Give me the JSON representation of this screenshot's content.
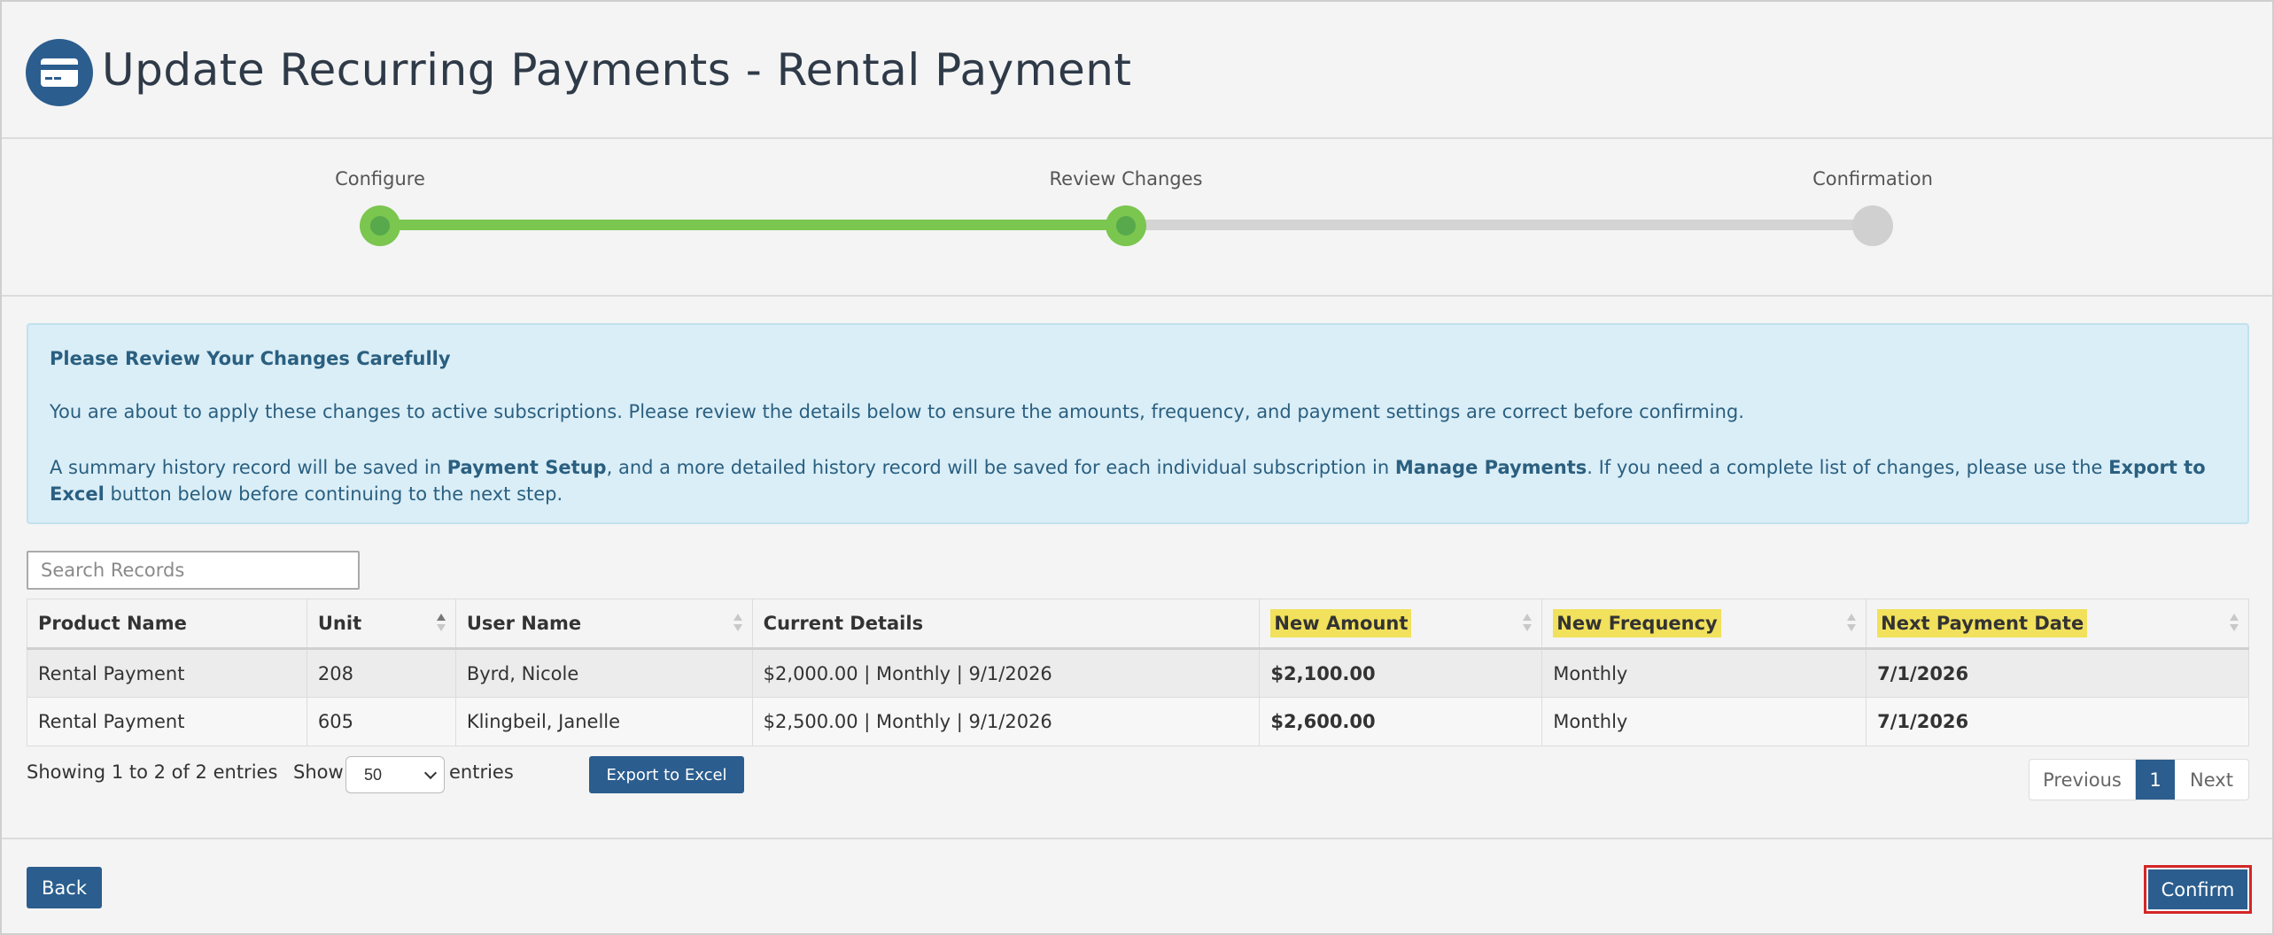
{
  "header": {
    "title": "Update Recurring Payments - Rental Payment",
    "icon": "credit-card-icon"
  },
  "stepper": {
    "steps": [
      {
        "label": "Configure",
        "state": "done"
      },
      {
        "label": "Review Changes",
        "state": "current"
      },
      {
        "label": "Confirmation",
        "state": "pending"
      }
    ],
    "colors": {
      "done": "#7ac64f",
      "pending": "#d0d0d0"
    }
  },
  "alert": {
    "title": "Please Review Your Changes Carefully",
    "p1": "You are about to apply these changes to active subscriptions. Please review the details below to ensure the amounts, frequency, and payment settings are correct before confirming.",
    "p2_a": "A summary history record will be saved in ",
    "p2_b": "Payment Setup",
    "p2_c": ", and a more detailed history record will be saved for each individual subscription in ",
    "p2_d": "Manage Payments",
    "p2_e": ". If you need a complete list of changes, please use the ",
    "p2_f": "Export to Excel",
    "p2_g": " button below before continuing to the next step."
  },
  "search": {
    "placeholder": "Search Records"
  },
  "table": {
    "headers": [
      "Product Name",
      "Unit",
      "User Name",
      "Current Details",
      "New Amount",
      "New Frequency",
      "Next Payment Date"
    ],
    "rows": [
      [
        "Rental Payment",
        "208",
        "Byrd, Nicole",
        "$2,000.00 | Monthly | 9/1/2026",
        "$2,100.00",
        "Monthly",
        "7/1/2026"
      ],
      [
        "Rental Payment",
        "605",
        "Klingbeil, Janelle",
        "$2,500.00 | Monthly | 9/1/2026",
        "$2,600.00",
        "Monthly",
        "7/1/2026"
      ]
    ]
  },
  "footer": {
    "showing": "Showing 1 to 2 of 2 entries",
    "show_label": "Show",
    "page_size": "50",
    "entries_label": "entries",
    "export_label": "Export to Excel",
    "prev_label": "Previous",
    "current_page": "1",
    "next_label": "Next"
  },
  "actions": {
    "back_label": "Back",
    "confirm_label": "Confirm"
  },
  "colors": {
    "primary": "#2b5d8e",
    "highlight": "#f1e15c",
    "alert_bg": "#daeef7",
    "confirm_outline": "#d32626"
  }
}
